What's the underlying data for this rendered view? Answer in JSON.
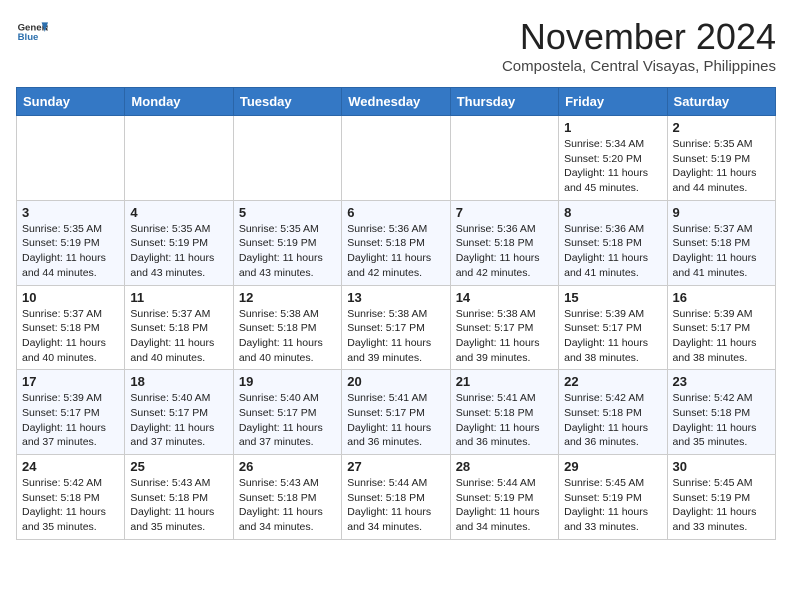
{
  "logo": {
    "general": "General",
    "blue": "Blue"
  },
  "title": "November 2024",
  "location": "Compostela, Central Visayas, Philippines",
  "days_of_week": [
    "Sunday",
    "Monday",
    "Tuesday",
    "Wednesday",
    "Thursday",
    "Friday",
    "Saturday"
  ],
  "weeks": [
    [
      null,
      null,
      null,
      null,
      null,
      {
        "day": "1",
        "sunrise": "5:34 AM",
        "sunset": "5:20 PM",
        "daylight": "11 hours and 45 minutes."
      },
      {
        "day": "2",
        "sunrise": "5:35 AM",
        "sunset": "5:19 PM",
        "daylight": "11 hours and 44 minutes."
      }
    ],
    [
      {
        "day": "3",
        "sunrise": "5:35 AM",
        "sunset": "5:19 PM",
        "daylight": "11 hours and 44 minutes."
      },
      {
        "day": "4",
        "sunrise": "5:35 AM",
        "sunset": "5:19 PM",
        "daylight": "11 hours and 43 minutes."
      },
      {
        "day": "5",
        "sunrise": "5:35 AM",
        "sunset": "5:19 PM",
        "daylight": "11 hours and 43 minutes."
      },
      {
        "day": "6",
        "sunrise": "5:36 AM",
        "sunset": "5:18 PM",
        "daylight": "11 hours and 42 minutes."
      },
      {
        "day": "7",
        "sunrise": "5:36 AM",
        "sunset": "5:18 PM",
        "daylight": "11 hours and 42 minutes."
      },
      {
        "day": "8",
        "sunrise": "5:36 AM",
        "sunset": "5:18 PM",
        "daylight": "11 hours and 41 minutes."
      },
      {
        "day": "9",
        "sunrise": "5:37 AM",
        "sunset": "5:18 PM",
        "daylight": "11 hours and 41 minutes."
      }
    ],
    [
      {
        "day": "10",
        "sunrise": "5:37 AM",
        "sunset": "5:18 PM",
        "daylight": "11 hours and 40 minutes."
      },
      {
        "day": "11",
        "sunrise": "5:37 AM",
        "sunset": "5:18 PM",
        "daylight": "11 hours and 40 minutes."
      },
      {
        "day": "12",
        "sunrise": "5:38 AM",
        "sunset": "5:18 PM",
        "daylight": "11 hours and 40 minutes."
      },
      {
        "day": "13",
        "sunrise": "5:38 AM",
        "sunset": "5:17 PM",
        "daylight": "11 hours and 39 minutes."
      },
      {
        "day": "14",
        "sunrise": "5:38 AM",
        "sunset": "5:17 PM",
        "daylight": "11 hours and 39 minutes."
      },
      {
        "day": "15",
        "sunrise": "5:39 AM",
        "sunset": "5:17 PM",
        "daylight": "11 hours and 38 minutes."
      },
      {
        "day": "16",
        "sunrise": "5:39 AM",
        "sunset": "5:17 PM",
        "daylight": "11 hours and 38 minutes."
      }
    ],
    [
      {
        "day": "17",
        "sunrise": "5:39 AM",
        "sunset": "5:17 PM",
        "daylight": "11 hours and 37 minutes."
      },
      {
        "day": "18",
        "sunrise": "5:40 AM",
        "sunset": "5:17 PM",
        "daylight": "11 hours and 37 minutes."
      },
      {
        "day": "19",
        "sunrise": "5:40 AM",
        "sunset": "5:17 PM",
        "daylight": "11 hours and 37 minutes."
      },
      {
        "day": "20",
        "sunrise": "5:41 AM",
        "sunset": "5:17 PM",
        "daylight": "11 hours and 36 minutes."
      },
      {
        "day": "21",
        "sunrise": "5:41 AM",
        "sunset": "5:18 PM",
        "daylight": "11 hours and 36 minutes."
      },
      {
        "day": "22",
        "sunrise": "5:42 AM",
        "sunset": "5:18 PM",
        "daylight": "11 hours and 36 minutes."
      },
      {
        "day": "23",
        "sunrise": "5:42 AM",
        "sunset": "5:18 PM",
        "daylight": "11 hours and 35 minutes."
      }
    ],
    [
      {
        "day": "24",
        "sunrise": "5:42 AM",
        "sunset": "5:18 PM",
        "daylight": "11 hours and 35 minutes."
      },
      {
        "day": "25",
        "sunrise": "5:43 AM",
        "sunset": "5:18 PM",
        "daylight": "11 hours and 35 minutes."
      },
      {
        "day": "26",
        "sunrise": "5:43 AM",
        "sunset": "5:18 PM",
        "daylight": "11 hours and 34 minutes."
      },
      {
        "day": "27",
        "sunrise": "5:44 AM",
        "sunset": "5:18 PM",
        "daylight": "11 hours and 34 minutes."
      },
      {
        "day": "28",
        "sunrise": "5:44 AM",
        "sunset": "5:19 PM",
        "daylight": "11 hours and 34 minutes."
      },
      {
        "day": "29",
        "sunrise": "5:45 AM",
        "sunset": "5:19 PM",
        "daylight": "11 hours and 33 minutes."
      },
      {
        "day": "30",
        "sunrise": "5:45 AM",
        "sunset": "5:19 PM",
        "daylight": "11 hours and 33 minutes."
      }
    ]
  ]
}
